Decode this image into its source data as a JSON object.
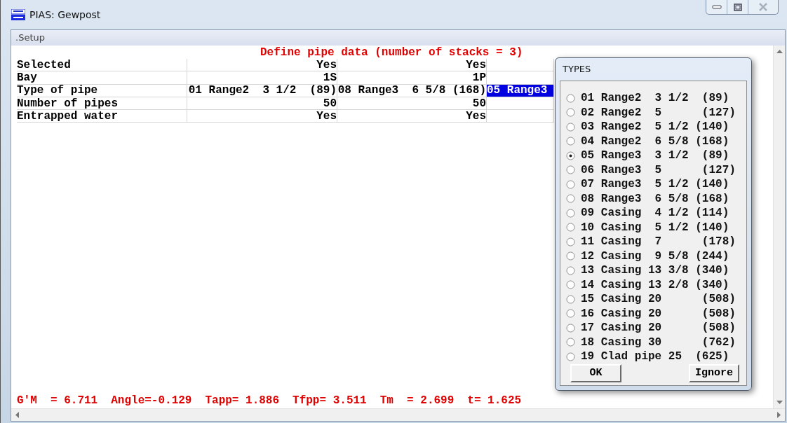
{
  "window": {
    "title": "PIAS: Gewpost"
  },
  "menu": [
    {
      "label": ".Setup"
    }
  ],
  "heading": "Define pipe data (number of stacks = 3)",
  "table": {
    "rows": [
      {
        "label": "Selected",
        "cells": [
          {
            "text": "Yes",
            "selected": false
          },
          {
            "text": "Yes",
            "selected": false
          },
          {
            "selected": false
          }
        ]
      },
      {
        "label": "Bay",
        "cells": [
          {
            "text": "1S",
            "selected": false
          },
          {
            "text": "1P",
            "selected": false
          },
          {
            "selected": false
          }
        ]
      },
      {
        "label": "Type of pipe",
        "cells": [
          {
            "text": "01 Range2  3 1/2  (89)",
            "selected": false
          },
          {
            "text": "08 Range3  6 5/8 (168)",
            "selected": false
          },
          {
            "text": "05 Range3",
            "selected": true
          }
        ]
      },
      {
        "label": "Number of pipes",
        "cells": [
          {
            "text": "50",
            "selected": false
          },
          {
            "text": "50",
            "selected": false
          },
          {
            "selected": false
          }
        ]
      },
      {
        "label": "Entrapped water",
        "cells": [
          {
            "text": "Yes",
            "selected": false
          },
          {
            "text": "Yes",
            "selected": false
          },
          {
            "selected": false
          }
        ]
      }
    ]
  },
  "status_bar": {
    "items": [
      "G'M  = 6.711",
      "Angle=-0.129",
      "Tapp= 1.886",
      "Tfpp= 3.511",
      "Tm  = 2.699",
      "t= 1.625"
    ]
  },
  "dialog": {
    "title": "TYPES",
    "items": [
      {
        "label": "01 Range2  3 1/2  (89)",
        "selected": false
      },
      {
        "label": "02 Range2  5      (127)",
        "selected": false
      },
      {
        "label": "03 Range2  5 1/2 (140)",
        "selected": false
      },
      {
        "label": "04 Range2  6 5/8 (168)",
        "selected": false
      },
      {
        "label": "05 Range3  3 1/2  (89)",
        "selected": true
      },
      {
        "label": "06 Range3  5      (127)",
        "selected": false
      },
      {
        "label": "07 Range3  5 1/2 (140)",
        "selected": false
      },
      {
        "label": "08 Range3  6 5/8 (168)",
        "selected": false
      },
      {
        "label": "09 Casing  4 1/2 (114)",
        "selected": false
      },
      {
        "label": "10 Casing  5 1/2 (140)",
        "selected": false
      },
      {
        "label": "11 Casing  7      (178)",
        "selected": false
      },
      {
        "label": "12 Casing  9 5/8 (244)",
        "selected": false
      },
      {
        "label": "13 Casing 13 3/8 (340)",
        "selected": false
      },
      {
        "label": "14 Casing 13 2/8 (340)",
        "selected": false
      },
      {
        "label": "15 Casing 20      (508)",
        "selected": false
      },
      {
        "label": "16 Casing 20      (508)",
        "selected": false
      },
      {
        "label": "17 Casing 20      (508)",
        "selected": false
      },
      {
        "label": "18 Casing 30      (762)",
        "selected": false
      },
      {
        "label": "19 Clad pipe 25  (625)",
        "selected": false
      }
    ],
    "buttons": [
      "OK",
      "Ignore"
    ]
  }
}
